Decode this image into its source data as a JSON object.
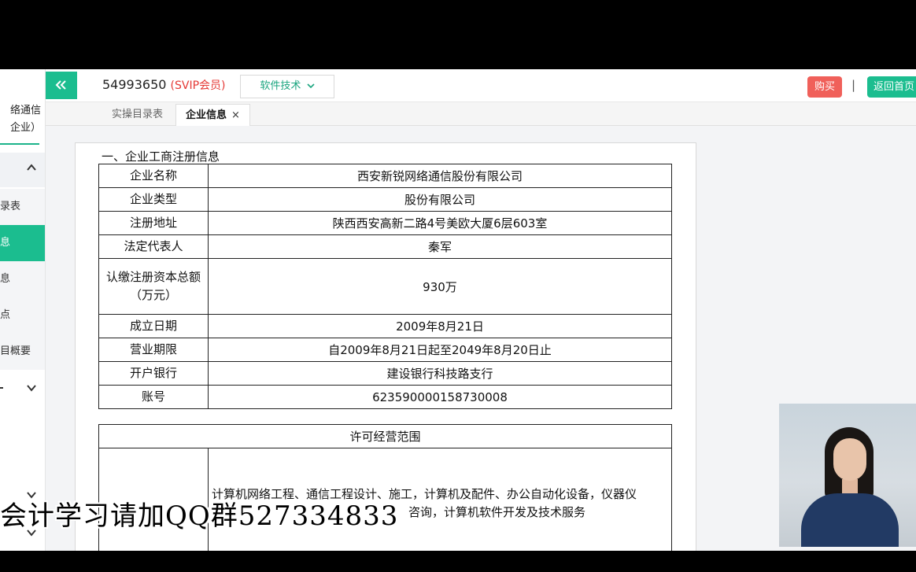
{
  "sidebar": {
    "company_name_lines": [
      "络通信",
      "企业）"
    ],
    "items": [
      {
        "label": "录表"
      },
      {
        "label": "息"
      },
      {
        "label": "息"
      },
      {
        "label": "点"
      },
      {
        "label": "目概要"
      }
    ]
  },
  "topbar": {
    "account_id": "54993650",
    "account_tier": "(SVIP会员)",
    "tech_dropdown": "软件技术",
    "buy_label": "购买",
    "separator": "|",
    "home_label": "返回首页"
  },
  "tabs": [
    {
      "label": "实操目录表"
    },
    {
      "label": "企业信息",
      "close": "×"
    }
  ],
  "document": {
    "heading": "一、企业工商注册信息",
    "rows": [
      {
        "key": "企业名称",
        "value": "西安新锐网络通信股份有限公司"
      },
      {
        "key": "企业类型",
        "value": "股份有限公司"
      },
      {
        "key": "注册地址",
        "value": "陕西西安高新二路4号美欧大厦6层603室"
      },
      {
        "key": "法定代表人",
        "value": "秦军"
      },
      {
        "key": "认缴注册资本总额（万元）",
        "value": "930万"
      },
      {
        "key": "成立日期",
        "value": "2009年8月21日"
      },
      {
        "key": "营业期限",
        "value": "自2009年8月21日起至2049年8月20日止"
      },
      {
        "key": "开户银行",
        "value": "建设银行科技路支行"
      },
      {
        "key": "账号",
        "value": "623590000158730008"
      }
    ],
    "scope_title": "许可经营范围",
    "scope_text_1": "计算机网络工程、通信工程设计、施工，计算机及配件、办公自动化设备，仪器仪",
    "scope_text_2": "咨询，计算机软件开发及技术服务"
  },
  "overlay": {
    "text": "会计学习请加QQ群527334833"
  }
}
